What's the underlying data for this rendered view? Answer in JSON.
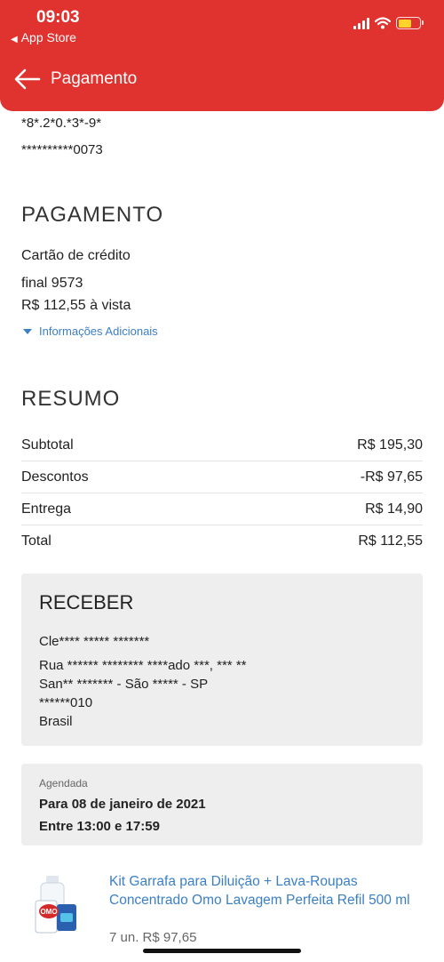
{
  "status_bar": {
    "time": "09:03",
    "back_app": "App Store"
  },
  "header": {
    "title": "Pagamento"
  },
  "masked_ids": {
    "doc": "*8*.2*0.*3*-9*",
    "card": "**********0073"
  },
  "payment": {
    "section_title": "PAGAMENTO",
    "method": "Cartão de crédito",
    "card_final": "final 9573",
    "amount": "R$ 112,55 à vista",
    "more_info": "Informações Adicionais"
  },
  "summary": {
    "section_title": "RESUMO",
    "rows": [
      {
        "label": "Subtotal",
        "value": "R$ 195,30"
      },
      {
        "label": "Descontos",
        "value": "-R$ 97,65"
      },
      {
        "label": "Entrega",
        "value": "R$ 14,90"
      },
      {
        "label": "Total",
        "value": "R$ 112,55"
      }
    ]
  },
  "receive": {
    "title": "RECEBER",
    "name": "Cle**** ***** *******",
    "street": "Rua ****** ******** ****ado ***, *** **",
    "city": "San** ******* - São ***** - SP",
    "zip": "******010",
    "country": "Brasil"
  },
  "schedule": {
    "label": "Agendada",
    "date": "Para 08 de janeiro de 2021",
    "time": "Entre 13:00 e 17:59"
  },
  "product": {
    "name": "Kit Garrafa para Diluição + Lava-Roupas Concentrado Omo Lavagem Perfeita Refil 500 ml",
    "qty_price": "7 un. R$ 97,65",
    "image_brand": "OMO"
  },
  "colors": {
    "brand_red": "#e0322e",
    "link_blue": "#3b7fc4",
    "card_gray": "#eeeeee"
  },
  "icons": {
    "back": "arrow-left-icon",
    "caret": "caret-down-icon",
    "battery": "battery-icon",
    "wifi": "wifi-icon",
    "signal": "signal-icon"
  }
}
